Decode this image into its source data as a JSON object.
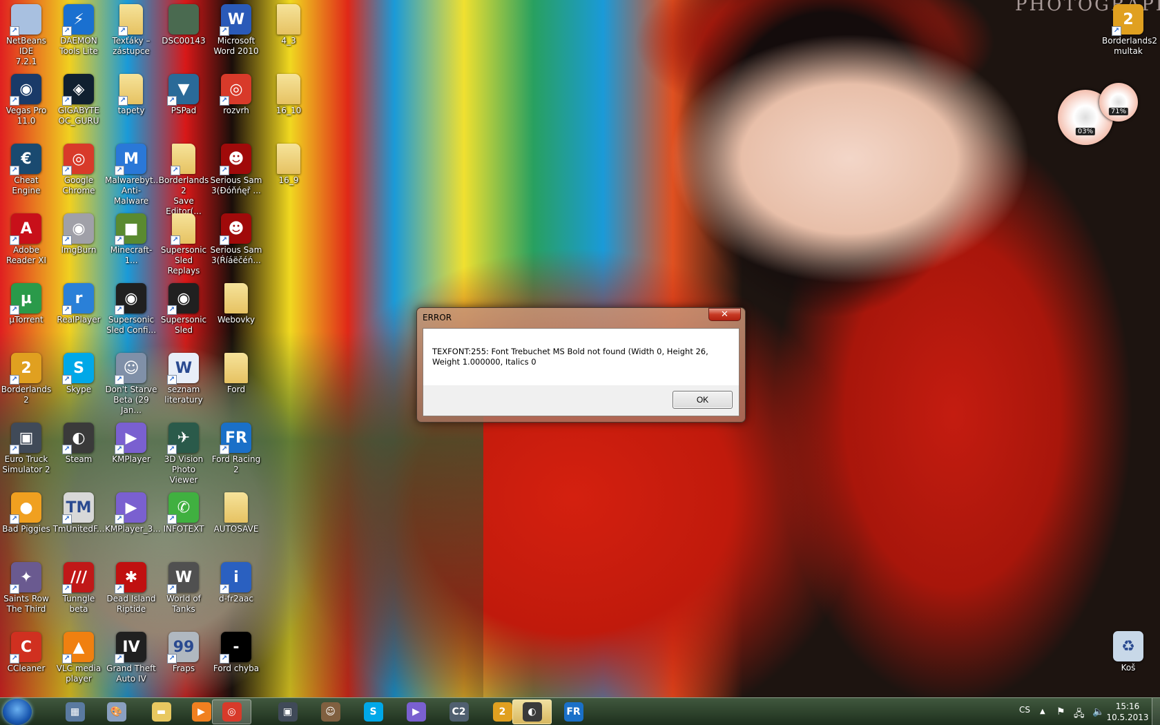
{
  "wallpaper": {
    "watermark": "PHOTOGRAPHY"
  },
  "desktop": {
    "columns": [
      [
        {
          "label": "NetBeans IDE\n7.2.1",
          "icon": "netbeans-icon",
          "color": "#a8c0e0",
          "glyph": ""
        },
        {
          "label": "Vegas Pro\n11.0",
          "icon": "vegas-pro-icon",
          "color": "#1a3a68",
          "glyph": "◉"
        },
        {
          "label": "Cheat Engine",
          "icon": "cheat-engine-icon",
          "color": "#1a4a70",
          "glyph": "€"
        },
        {
          "label": "Adobe\nReader XI",
          "icon": "adobe-reader-icon",
          "color": "#c8101a",
          "glyph": "A"
        },
        {
          "label": "µTorrent",
          "icon": "utorrent-icon",
          "color": "#2a9a4a",
          "glyph": "µ"
        },
        {
          "label": "Borderlands 2",
          "icon": "borderlands2-icon",
          "color": "#e0a020",
          "glyph": "2"
        },
        {
          "label": "Euro Truck\nSimulator 2",
          "icon": "euro-truck-icon",
          "color": "#404a58",
          "glyph": "▣"
        },
        {
          "label": "Bad Piggies",
          "icon": "bad-piggies-icon",
          "color": "#f0a020",
          "glyph": "●"
        },
        {
          "label": "Saints Row\nThe Third",
          "icon": "saints-row-icon",
          "color": "#6a5a90",
          "glyph": "✦"
        },
        {
          "label": "CCleaner",
          "icon": "ccleaner-icon",
          "color": "#d03020",
          "glyph": "C"
        }
      ],
      [
        {
          "label": "DAEMON\nTools Lite",
          "icon": "daemon-tools-icon",
          "color": "#1a70d0",
          "glyph": "⚡"
        },
        {
          "label": "GIGABYTE\nOC_GURU",
          "icon": "gigabyte-icon",
          "color": "#102030",
          "glyph": "◈"
        },
        {
          "label": "Google\nChrome",
          "icon": "chrome-icon",
          "color": "#d83a2a",
          "glyph": "◎"
        },
        {
          "label": "ImgBurn",
          "icon": "imgburn-icon",
          "color": "#a0a0a8",
          "glyph": "◉"
        },
        {
          "label": "RealPlayer",
          "icon": "realplayer-icon",
          "color": "#2a80d8",
          "glyph": "r"
        },
        {
          "label": "Skype",
          "icon": "skype-icon",
          "color": "#00a8e8",
          "glyph": "S"
        },
        {
          "label": "Steam",
          "icon": "steam-icon",
          "color": "#3a3a3a",
          "glyph": "◐"
        },
        {
          "label": "TmUnitedF...",
          "icon": "trackmania-icon",
          "color": "#d8d8d8",
          "glyph": "TM"
        },
        {
          "label": "Tunngle beta",
          "icon": "tunngle-icon",
          "color": "#c01818",
          "glyph": "///"
        },
        {
          "label": "VLC media\nplayer",
          "icon": "vlc-icon",
          "color": "#f08010",
          "glyph": "▲"
        }
      ],
      [
        {
          "label": "Texťáky –\nzástupce",
          "icon": "folder-icon",
          "color": "#f0d070",
          "glyph": ""
        },
        {
          "label": "tapety",
          "icon": "folder-icon",
          "color": "#f0d070",
          "glyph": ""
        },
        {
          "label": "Malwarebyt...\nAnti-Malware",
          "icon": "malwarebytes-icon",
          "color": "#2a78d8",
          "glyph": "M"
        },
        {
          "label": "Minecraft-1...",
          "icon": "minecraft-icon",
          "color": "#5a8a30",
          "glyph": "■"
        },
        {
          "label": "Supersonic\nSled Confi...",
          "icon": "nvidia-icon",
          "color": "#202020",
          "glyph": "◉"
        },
        {
          "label": "Don't Starve\nBeta (29 Jan...",
          "icon": "dont-starve-icon",
          "color": "#8090a8",
          "glyph": "☺"
        },
        {
          "label": "KMPlayer",
          "icon": "kmplayer-icon",
          "color": "#7a60d0",
          "glyph": "▶"
        },
        {
          "label": "KMPlayer_3...",
          "icon": "kmplayer-icon",
          "color": "#7a60d0",
          "glyph": "▶"
        },
        {
          "label": "Dead Island\nRiptide",
          "icon": "dead-island-icon",
          "color": "#c01010",
          "glyph": "✱"
        },
        {
          "label": "Grand Theft\nAuto IV",
          "icon": "gta-iv-icon",
          "color": "#202020",
          "glyph": "IV"
        }
      ],
      [
        {
          "label": "DSC00143",
          "icon": "photo-icon",
          "color": "#4a6a50",
          "glyph": ""
        },
        {
          "label": "PSPad",
          "icon": "pspad-icon",
          "color": "#2a6a98",
          "glyph": "▼"
        },
        {
          "label": "Borderlands 2\nSave Editor(...",
          "icon": "folder-icon",
          "color": "#f0d070",
          "glyph": ""
        },
        {
          "label": "Supersonic\nSled Replays",
          "icon": "folder-icon",
          "color": "#f0d070",
          "glyph": ""
        },
        {
          "label": "Supersonic\nSled",
          "icon": "nvidia-icon",
          "color": "#202020",
          "glyph": "◉"
        },
        {
          "label": "seznam\nliteratury",
          "icon": "word-document-icon",
          "color": "#e8eef8",
          "glyph": "W"
        },
        {
          "label": "3D Vision\nPhoto Viewer",
          "icon": "3d-vision-icon",
          "color": "#2a5a4a",
          "glyph": "✈"
        },
        {
          "label": "INFOTEXT",
          "icon": "phone-icon",
          "color": "#40b040",
          "glyph": "✆"
        },
        {
          "label": "World of\nTanks",
          "icon": "world-of-tanks-icon",
          "color": "#505050",
          "glyph": "W"
        },
        {
          "label": "Fraps",
          "icon": "fraps-icon",
          "color": "#b0b8c0",
          "glyph": "99"
        }
      ],
      [
        {
          "label": "Microsoft\nWord 2010",
          "icon": "word-icon",
          "color": "#2a5ab8",
          "glyph": "W"
        },
        {
          "label": "rozvrh",
          "icon": "chrome-icon",
          "color": "#d83a2a",
          "glyph": "◎"
        },
        {
          "label": "Serious Sam\n3(Đóňńęř ...",
          "icon": "serious-sam-icon",
          "color": "#a00a0a",
          "glyph": "☻"
        },
        {
          "label": "Serious Sam\n3(Ŕíáëčéń...",
          "icon": "serious-sam-icon",
          "color": "#a00a0a",
          "glyph": "☻"
        },
        {
          "label": "Webovky",
          "icon": "folder-icon",
          "color": "#f0d070",
          "glyph": ""
        },
        {
          "label": "Ford",
          "icon": "folder-icon",
          "color": "#f0d070",
          "glyph": ""
        },
        {
          "label": "Ford Racing 2",
          "icon": "ford-racing-icon",
          "color": "#1a70c8",
          "glyph": "FR"
        },
        {
          "label": "AUTOSAVE",
          "icon": "folder-icon",
          "color": "#f0d070",
          "glyph": ""
        },
        {
          "label": "d-fr2aac",
          "icon": "info-monitor-icon",
          "color": "#2a60c0",
          "glyph": "i"
        },
        {
          "label": "Ford chyba",
          "icon": "black-file-icon",
          "color": "#000000",
          "glyph": "-"
        }
      ],
      [
        {
          "label": "4_3",
          "icon": "folder-icon",
          "color": "#f0d070",
          "glyph": ""
        },
        {
          "label": "16_10",
          "icon": "folder-icon",
          "color": "#f0d070",
          "glyph": ""
        },
        {
          "label": "16_9",
          "icon": "folder-icon",
          "color": "#f0d070",
          "glyph": ""
        }
      ]
    ],
    "right": [
      {
        "label": "Borderlands2\nmultak",
        "icon": "borderlands2-icon",
        "color": "#e0a020",
        "glyph": "2"
      },
      {
        "label": "Koš",
        "icon": "recycle-bin-icon",
        "color": "#c8d8e8",
        "glyph": "♻"
      }
    ]
  },
  "gadget": {
    "cpu": "03%",
    "memory": "71%",
    "cpu_value": 3,
    "memory_value": 71
  },
  "dialog": {
    "title": "ERROR",
    "message": "TEXFONT:255: Font Trebuchet MS Bold not found (Width 0, Height 26, Weight 1.000000, Italics 0",
    "ok_label": "OK",
    "close_glyph": "✕"
  },
  "taskbar": {
    "items": [
      {
        "name": "calculator",
        "color": "#5a7aa0",
        "glyph": "▦",
        "state": ""
      },
      {
        "name": "paint",
        "color": "#8aa0c0",
        "glyph": "🎨",
        "state": ""
      },
      {
        "name": "windows-explorer",
        "color": "#e8c860",
        "glyph": "▬",
        "state": ""
      },
      {
        "name": "media-player",
        "color": "#f08020",
        "glyph": "▶",
        "state": ""
      },
      {
        "name": "chrome",
        "color": "#d83a2a",
        "glyph": "◎",
        "state": "active"
      },
      {
        "name": "euro-truck-simulator",
        "color": "#404a58",
        "glyph": "▣",
        "state": ""
      },
      {
        "name": "gta-san-andreas",
        "color": "#806040",
        "glyph": "☺",
        "state": ""
      },
      {
        "name": "skype",
        "color": "#00a8e8",
        "glyph": "S",
        "state": ""
      },
      {
        "name": "kmplayer",
        "color": "#7a60d0",
        "glyph": "▶",
        "state": ""
      },
      {
        "name": "crysis-2",
        "color": "#506070",
        "glyph": "C2",
        "state": ""
      },
      {
        "name": "borderlands-2",
        "color": "#e0a020",
        "glyph": "2",
        "state": ""
      },
      {
        "name": "steam",
        "color": "#3a3a3a",
        "glyph": "◐",
        "state": "hl"
      },
      {
        "name": "ford-racing-2",
        "color": "#1a70c8",
        "glyph": "FR",
        "state": ""
      }
    ],
    "language": "CS",
    "tray_up": "▲",
    "time": "15:16",
    "date": "10.5.2013"
  }
}
